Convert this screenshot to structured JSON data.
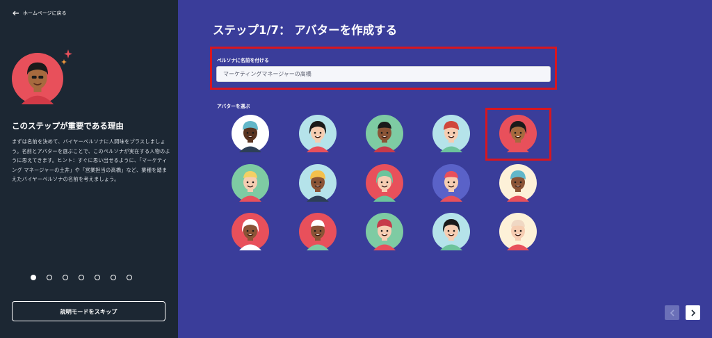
{
  "sidebar": {
    "back_label": "ホームページに戻る",
    "why_title": "このステップが重要である理由",
    "why_text": "まずは名前を決めて、バイヤーペルソナに人間味をプラスしましょう。名前とアバターを選ぶことで、このペルソナが実在する人物のように思えてきます。ヒント：すぐに思い出せるように、「マーケティング マネージャーの土井」や「営業担当の高橋」など、業種を踏まえたバイヤーペルソナの名前を考えましょう。",
    "steps_total": 7,
    "steps_current": 1,
    "skip_label": "説明モードをスキップ"
  },
  "main": {
    "title": "ステップ1/7： アバターを作成する",
    "name_label": "ペルソナに名前を付ける",
    "name_value": "マーケティングマネージャーの高橋",
    "choose_label": "アバターを選ぶ",
    "selected_avatar": 5
  },
  "avatars": [
    {
      "name": "beanie-man",
      "bg": "#ffffff",
      "skin": "#5a3420",
      "hair": "#62b7c9",
      "shirt": "#2d3f56"
    },
    {
      "name": "bun-hair-woman",
      "bg": "#b5e3ea",
      "skin": "#f6cdb2",
      "hair": "#1a1a1a",
      "shirt": "#e8505b"
    },
    {
      "name": "curly-hair-woman",
      "bg": "#7ecba3",
      "skin": "#8a5436",
      "hair": "#1a1a1a",
      "shirt": "#c73a4a"
    },
    {
      "name": "redhead-man",
      "bg": "#b5e3ea",
      "skin": "#f6cdb2",
      "hair": "#d0473b",
      "shirt": "#6cc49c"
    },
    {
      "name": "headphones-man",
      "bg": "#e8505b",
      "skin": "#a66a3e",
      "hair": "#1a1a1a",
      "shirt": "#e8505b"
    },
    {
      "name": "blonde-woman",
      "bg": "#7ecba3",
      "skin": "#f6cdb2",
      "hair": "#f3d064",
      "shirt": "#e8505b"
    },
    {
      "name": "blonde-man",
      "bg": "#b5e3ea",
      "skin": "#8a5436",
      "hair": "#f3c04c",
      "shirt": "#2d3f56"
    },
    {
      "name": "mustache-man",
      "bg": "#e8505b",
      "skin": "#f6cdb2",
      "hair": "#6cc49c",
      "shirt": "#6cc49c"
    },
    {
      "name": "red-hair-woman",
      "bg": "#5a62c8",
      "skin": "#f6cdb2",
      "hair": "#e8505b",
      "shirt": "#e8505b"
    },
    {
      "name": "goggles-man",
      "bg": "#fdf1d8",
      "skin": "#8a5436",
      "hair": "#62b7c9",
      "shirt": "#e8505b"
    },
    {
      "name": "white-hair-woman",
      "bg": "#e8505b",
      "skin": "#8a5436",
      "hair": "#ffffff",
      "shirt": "#ffffff"
    },
    {
      "name": "white-beard-man",
      "bg": "#e8505b",
      "skin": "#8a5436",
      "hair": "#ffffff",
      "shirt": "#7ecba3"
    },
    {
      "name": "glasses-woman",
      "bg": "#7ecba3",
      "skin": "#f6cdb2",
      "hair": "#c73a4a",
      "shirt": "#e8505b"
    },
    {
      "name": "bearded-man",
      "bg": "#b5e3ea",
      "skin": "#f6cdb2",
      "hair": "#1a1a1a",
      "shirt": "#6cc49c"
    },
    {
      "name": "bald-man",
      "bg": "#fdf1d8",
      "skin": "#f6cdb2",
      "hair": "#f0d8c4",
      "shirt": "#e8505b"
    }
  ]
}
